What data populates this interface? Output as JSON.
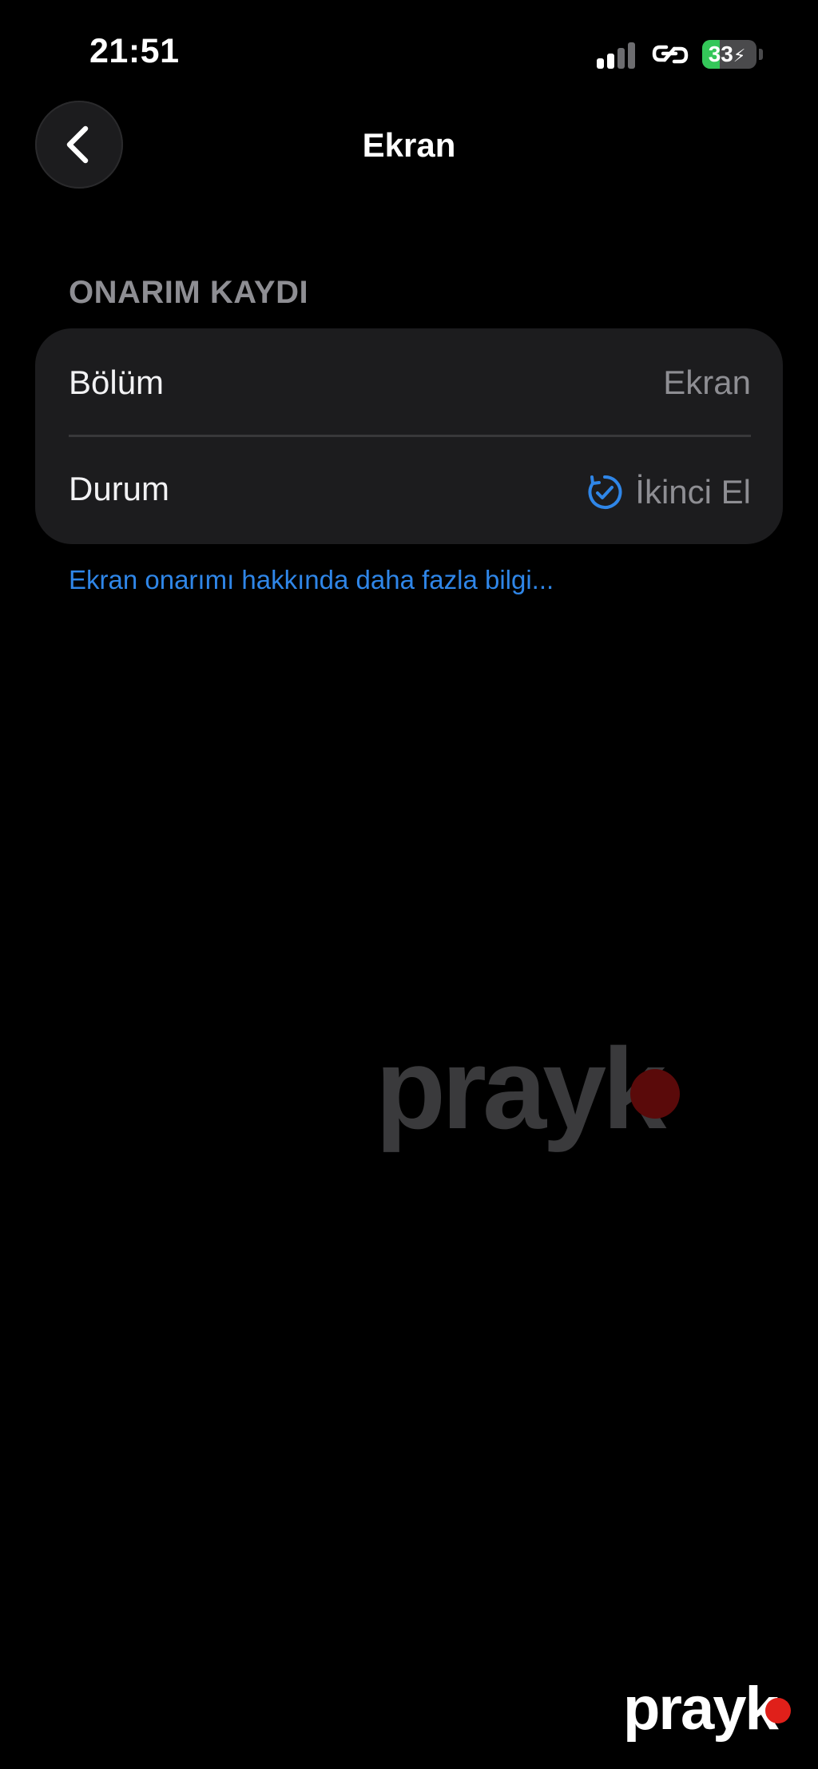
{
  "status_bar": {
    "time": "21:51",
    "battery_percent": "33",
    "battery_level": 0.33
  },
  "nav": {
    "title": "Ekran"
  },
  "section": {
    "header": "ONARIM KAYDI",
    "rows": [
      {
        "label": "Bölüm",
        "value": "Ekran"
      },
      {
        "label": "Durum",
        "value": "İkinci El"
      }
    ]
  },
  "info_link": "Ekran onarımı hakkında daha fazla bilgi...",
  "watermark": {
    "text": "prayk"
  },
  "colors": {
    "background": "#000000",
    "card": "#1c1c1e",
    "accent": "#2f86e8",
    "secondary_text": "#8e8e93",
    "battery_green": "#34c759",
    "watermark_red": "#e0201a"
  },
  "icons": {
    "back": "chevron-left-icon",
    "status": "checkmark-refresh-icon",
    "link": "link-icon",
    "signal": "cellular-signal-icon",
    "battery": "battery-charging-icon"
  }
}
